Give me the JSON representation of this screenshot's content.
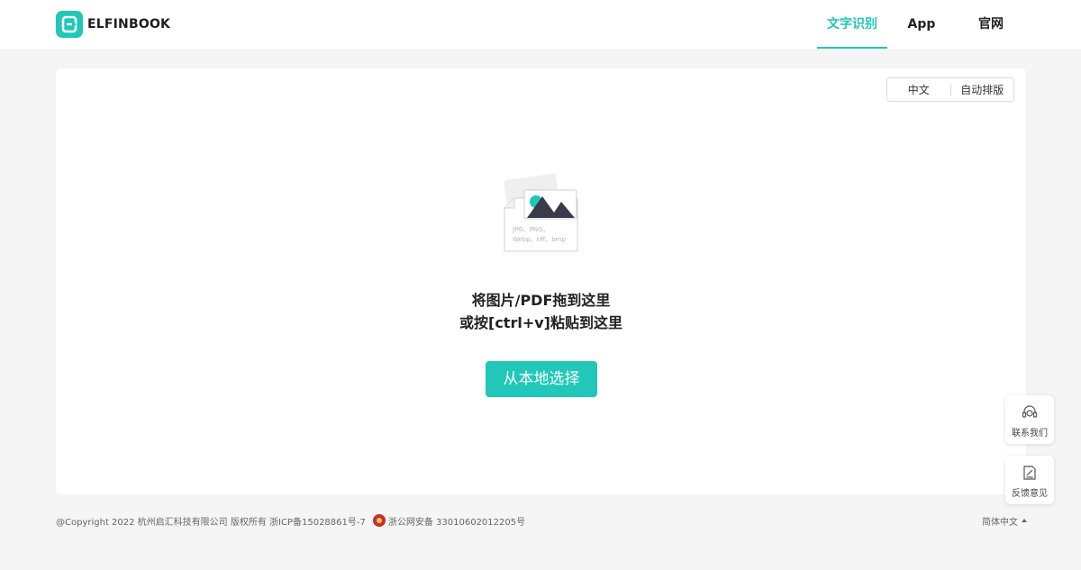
{
  "header": {
    "logo_text": "ELFINBOOK",
    "nav": [
      {
        "label": "文字识别",
        "active": true
      },
      {
        "label": "App",
        "active": false
      },
      {
        "label": "官网",
        "active": false
      }
    ]
  },
  "card": {
    "lang_options": [
      "中文",
      "自动排版"
    ],
    "illustration_formats_line1": "JPG、PNG、",
    "illustration_formats_line2": "Webp、tiff、bmp",
    "drop_line1": "将图片/PDF拖到这里",
    "drop_line2": "或按[ctrl+v]粘贴到这里",
    "pick_button": "从本地选择"
  },
  "float": {
    "contact_label": "联系我们",
    "feedback_label": "反馈意见"
  },
  "footer": {
    "copyright": "@Copyright 2022 杭州启汇科技有限公司 版权所有 浙ICP备15028861号-7",
    "police_record": "浙公网安备 33010602012205号",
    "language": "简体中文"
  },
  "colors": {
    "accent": "#21c7b8",
    "background": "#f5f5f5"
  }
}
